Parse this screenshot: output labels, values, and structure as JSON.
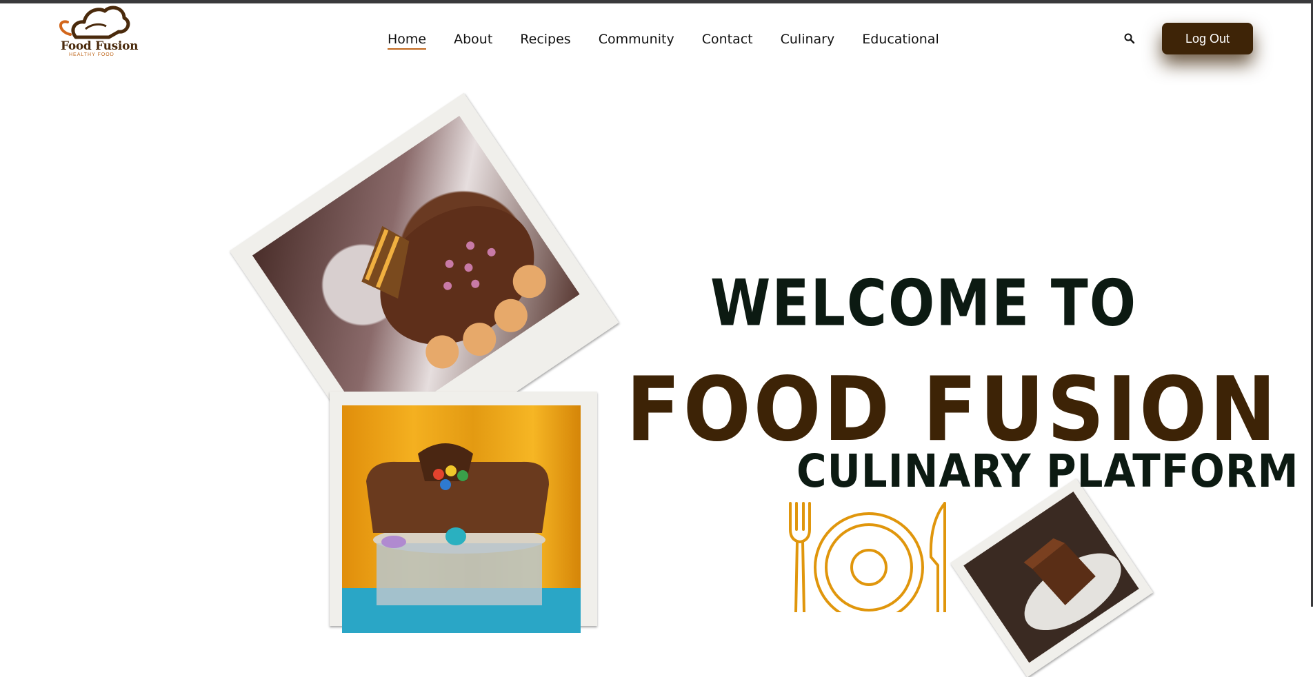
{
  "brand": {
    "name": "Food Fusion",
    "tagline": "HEALTHY FOOD"
  },
  "nav": {
    "items": [
      {
        "label": "Home",
        "active": true
      },
      {
        "label": "About"
      },
      {
        "label": "Recipes"
      },
      {
        "label": "Community"
      },
      {
        "label": "Contact"
      },
      {
        "label": "Culinary"
      },
      {
        "label": "Educational"
      }
    ]
  },
  "header": {
    "search_icon": "search-icon",
    "logout_label": "Log Out"
  },
  "hero": {
    "line1": "WELCOME TO",
    "line2": "FOOD FUSION",
    "line3": "CULINARY PLATFORM"
  },
  "colors": {
    "brand_brown": "#3e2407",
    "accent_orange": "#e0960c",
    "active_underline": "#c0651a"
  }
}
